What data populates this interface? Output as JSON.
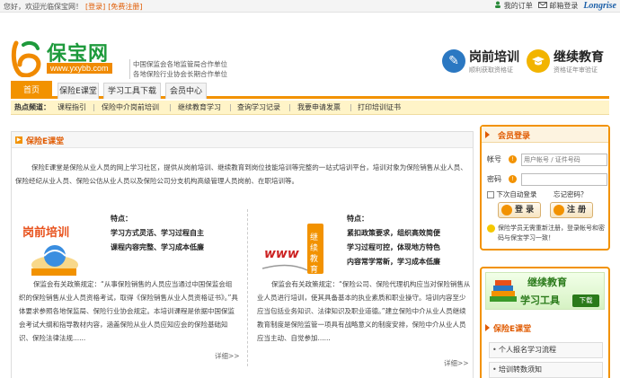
{
  "topbar": {
    "welcome": "您好，欢迎光临保宝网！",
    "login_link": "[登录]",
    "register_link": "[免费注册]",
    "my_orders": "我的订单",
    "mailbox_login": "邮箱登录",
    "brand": "Longrise"
  },
  "header": {
    "brand_name": "保宝网",
    "domain": "www.yxybb.com",
    "slogan_line1": "中国保监会各地监管局合作单位",
    "slogan_line2": "各地保险行业协会长期合作单位",
    "promo_pre_training": {
      "title": "岗前培训",
      "subtitle": "顺利获取资格证"
    },
    "promo_cont_edu": {
      "title": "继续教育",
      "subtitle": "资格证年审验证"
    }
  },
  "nav": {
    "tabs": [
      {
        "label": "首页",
        "active": true
      },
      {
        "label": "保险E课堂",
        "active": false
      },
      {
        "label": "学习工具下载",
        "active": false
      },
      {
        "label": "会员中心",
        "active": false
      }
    ]
  },
  "hotbar": {
    "label": "热点频道：",
    "links": [
      "课程指引",
      "保险中介岗前培训",
      "继续教育学习",
      "查询学习记录",
      "我要申请发票",
      "打印培训证书"
    ]
  },
  "main": {
    "title": "保险E课堂",
    "intro": "保险E课堂是保险从业人员的网上学习社区，提供从岗前培训、继续教育到岗位技能培训等完整的一站式培训平台，培训对象为保险销售从业人员、保险经纪从业人员、保险公估从业人员以及保险公司分支机构高级管理人员岗前、在职培训等。",
    "left": {
      "features_title": "特点：",
      "features": [
        "学习方式灵活、学习过程自主",
        "课程内容完整、学习成本低廉"
      ],
      "text": "保监会有关政策规定：“从事保险销售的人员应当通过中国保监会组织的保险销售从业人员资格考试，取得《保险销售从业人员资格证书》。”具体要求参照各地保监局、保险行业协会规定。本培训课程是依据中国保监会考试大纲和指导教材内容，涵盖保险从业人员应知应会的保险基础知识、保险法律法规......",
      "more": "详细>>"
    },
    "right": {
      "features_title": "特点：",
      "features": [
        "紧扣政策要求，组织高效简便",
        "学习过程可控，体现地方特色",
        "内容常学常新，学习成本低廉"
      ],
      "text": "保监会有关政策规定：“保险公司、保险代理机构应当对保险销售从业人员进行培训，使其具备基本的执业素质和职业操守。培训内容至少应当包括业务知识、法律知识及职业道德。”建立保险中介从业人员继续教育制度是保险监管一项具有战略意义的制度安排，保险中介从业人员应当主动、自觉参加......",
      "more": "详细>>"
    }
  },
  "login": {
    "title": "会员登录",
    "account_label": "帐号",
    "account_placeholder": "用户帐号 / 证件号码",
    "password_label": "密码",
    "remember": "下次自动登录",
    "forgot": "忘记密码？",
    "login_button": "登 录",
    "register_button": "注 册",
    "notice": "保险学员无需重新注册，登录帐号和密码与保宝学习一致！"
  },
  "sidebar": {
    "banner_line1": "继续教育",
    "banner_line2": "学习工具",
    "download": "下载",
    "section_title": "保险E课堂",
    "items": [
      "个人报名学习流程",
      "培训转数须知"
    ]
  }
}
